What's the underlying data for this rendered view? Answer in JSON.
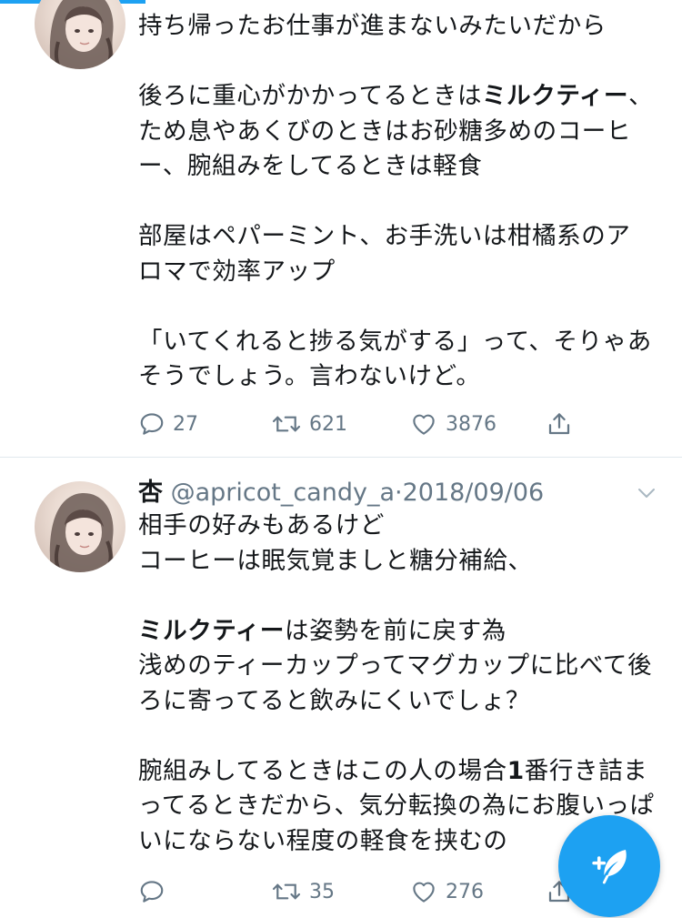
{
  "tweets": [
    {
      "author_name": "",
      "handle": "",
      "date": "",
      "paragraphs": [
        [
          {
            "t": "持ち帰ったお仕事が進まないみたいだから"
          }
        ],
        [
          {
            "t": "後ろに重心がかかってるときは"
          },
          {
            "t": "ミルクティー",
            "b": true
          },
          {
            "t": "、ため息やあくびのときはお砂糖多めのコーヒー、腕組みをしてるときは軽食"
          }
        ],
        [
          {
            "t": "部屋はペパーミント、お手洗いは柑橘系のアロマで効率アップ"
          }
        ],
        [
          {
            "t": "「いてくれると捗る気がする」って、そりゃあそうでしょう。言わないけど。"
          }
        ]
      ],
      "reply_count": "27",
      "retweet_count": "621",
      "like_count": "3876"
    },
    {
      "author_name": "杏",
      "handle": "@apricot_candy_a",
      "date": "2018/09/06",
      "paragraphs": [
        [
          {
            "t": "相手の好みもあるけど"
          }
        ],
        [
          {
            "t": "コーヒーは眠気覚ましと糖分補給、"
          }
        ],
        [
          {
            "t": ""
          }
        ],
        [
          {
            "t": "ミルクティー",
            "b": true
          },
          {
            "t": "は姿勢を前に戻す為"
          }
        ],
        [
          {
            "t": "浅めのティーカップってマグカップに比べて後ろに寄ってると飲みにくいでしょ？"
          }
        ],
        [
          {
            "t": ""
          }
        ],
        [
          {
            "t": "腕組みしてるときはこの人の場合"
          },
          {
            "t": "1",
            "b": true
          },
          {
            "t": "番行き詰まってるときだから、気分転換の為にお腹いっぱいにならない程度の軽食を挟むの"
          }
        ]
      ],
      "reply_count": "",
      "retweet_count": "35",
      "like_count": "276"
    }
  ],
  "icons": {
    "reply": "reply-icon",
    "retweet": "retweet-icon",
    "like": "heart-icon",
    "share": "share-icon",
    "caret": "chevron-down-icon",
    "compose": "compose-tweet-icon"
  },
  "colors": {
    "accent": "#1da1f2",
    "text": "#14171a",
    "secondary": "#657786",
    "divider": "#e1e8ed"
  }
}
